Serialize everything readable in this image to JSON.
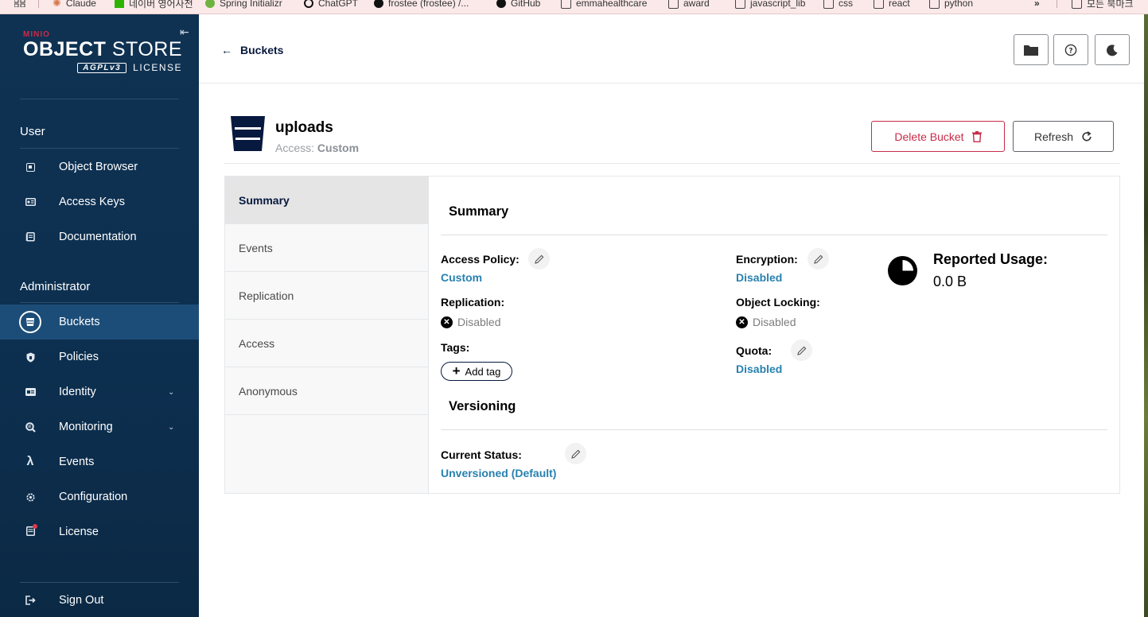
{
  "browser": {
    "bookmarks": [
      {
        "label": "Claude"
      },
      {
        "label": "네이버 영어사전"
      },
      {
        "label": "Spring Initializr"
      },
      {
        "label": "ChatGPT"
      },
      {
        "label": "frostee (frostee) /..."
      },
      {
        "label": "GitHub"
      },
      {
        "label": "emmahealthcare"
      },
      {
        "label": "award"
      },
      {
        "label": "javascript_lib"
      },
      {
        "label": "css"
      },
      {
        "label": "react"
      },
      {
        "label": "python"
      }
    ],
    "more": "»",
    "all_bookmarks": "모든 북마크"
  },
  "sidebar": {
    "brand_top": "MINIO",
    "brand_main_bold": "OBJECT",
    "brand_main_light": " STORE",
    "brand_badge": "AGPLv3",
    "brand_license": "LICENSE",
    "user_section": "User",
    "user_items": [
      {
        "label": "Object Browser",
        "icon": "object-browser-icon"
      },
      {
        "label": "Access Keys",
        "icon": "access-keys-icon"
      },
      {
        "label": "Documentation",
        "icon": "documentation-icon"
      }
    ],
    "admin_section": "Administrator",
    "admin_items": [
      {
        "label": "Buckets",
        "icon": "bucket-icon",
        "active": true
      },
      {
        "label": "Policies",
        "icon": "shield-icon"
      },
      {
        "label": "Identity",
        "icon": "id-card-icon",
        "expandable": true
      },
      {
        "label": "Monitoring",
        "icon": "magnifier-icon",
        "expandable": true
      },
      {
        "label": "Events",
        "icon": "lambda-icon",
        "glyph": "λ"
      },
      {
        "label": "Configuration",
        "icon": "gear-icon"
      },
      {
        "label": "License",
        "icon": "license-icon"
      }
    ],
    "sign_out": "Sign Out"
  },
  "header": {
    "back_label": "Buckets"
  },
  "bucket": {
    "name": "uploads",
    "access_label": "Access:",
    "access_value": "Custom",
    "delete_label": "Delete Bucket",
    "refresh_label": "Refresh"
  },
  "tabs": [
    {
      "label": "Summary",
      "active": true
    },
    {
      "label": "Events"
    },
    {
      "label": "Replication"
    },
    {
      "label": "Access"
    },
    {
      "label": "Anonymous"
    }
  ],
  "summary": {
    "title": "Summary",
    "access_policy_label": "Access Policy:",
    "access_policy_value": "Custom",
    "replication_label": "Replication:",
    "replication_value": "Disabled",
    "tags_label": "Tags:",
    "add_tag_label": "Add tag",
    "encryption_label": "Encryption:",
    "encryption_value": "Disabled",
    "object_locking_label": "Object Locking:",
    "object_locking_value": "Disabled",
    "quota_label": "Quota:",
    "quota_value": "Disabled",
    "usage_label": "Reported Usage:",
    "usage_value": "0.0 B"
  },
  "versioning": {
    "title": "Versioning",
    "status_label": "Current Status:",
    "status_value": "Unversioned (Default)"
  },
  "colors": {
    "sidebar_bg": "#0f3253",
    "sidebar_active": "#1c4d78",
    "danger": "#c72c48",
    "link": "#2781b0",
    "navy": "#07193e"
  }
}
